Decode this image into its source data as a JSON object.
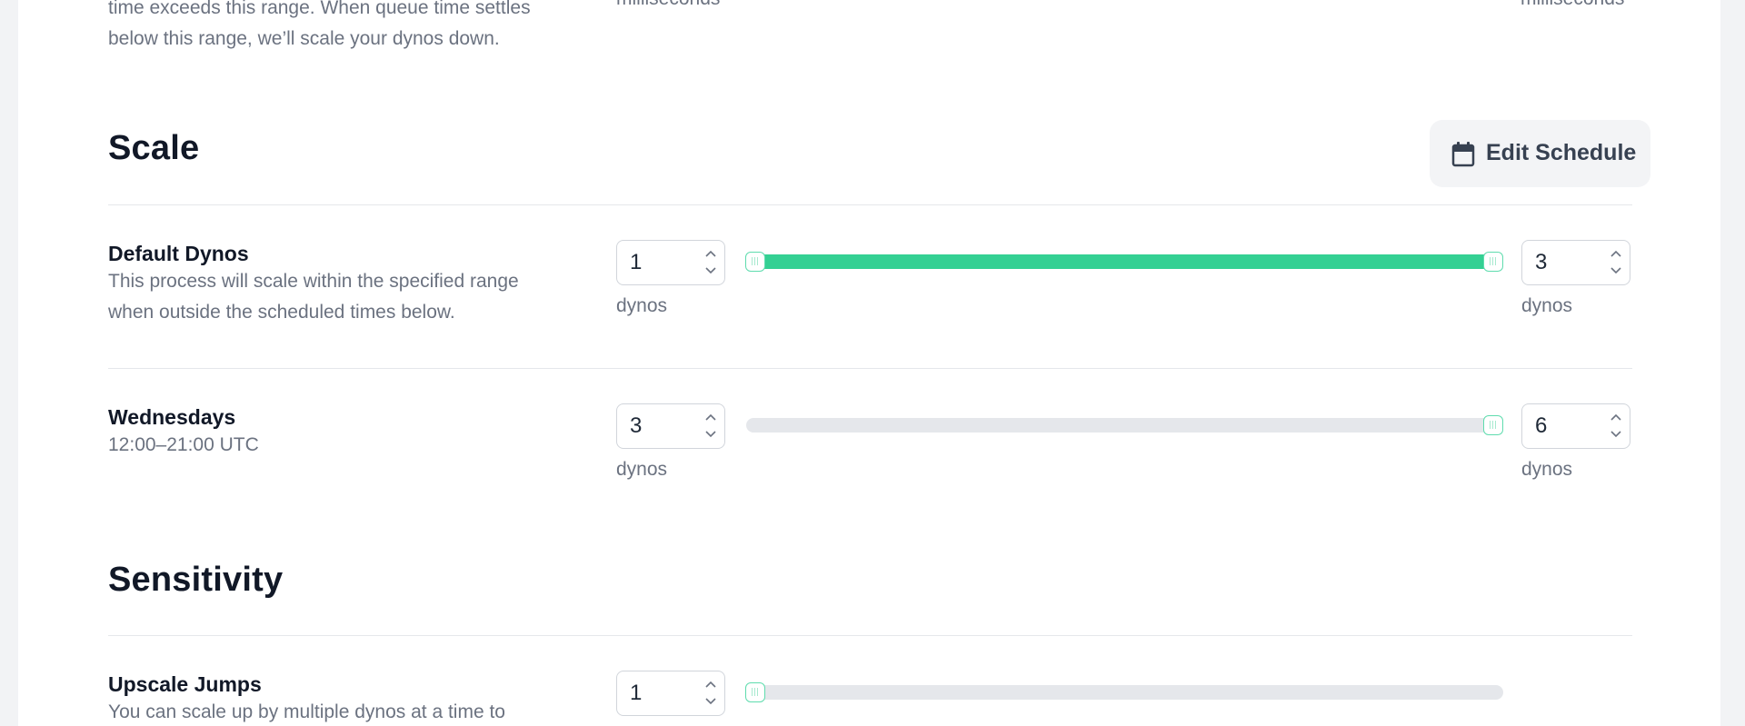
{
  "queue_time": {
    "description_line1": "time exceeds this range. When queue time settles",
    "description_line2": "below this range, we’ll scale your dynos down.",
    "min_unit": "milliseconds",
    "max_unit": "milliseconds"
  },
  "scale": {
    "title": "Scale",
    "edit_schedule_label": "Edit Schedule",
    "icon": "calendar-icon",
    "rows": [
      {
        "title": "Default Dynos",
        "description_line1": "This process will scale within the specified range",
        "description_line2": "when outside the scheduled times below.",
        "min_value": "1",
        "max_value": "3",
        "min_unit": "dynos",
        "max_unit": "dynos",
        "range_fill": 1.0
      },
      {
        "title": "Wednesdays",
        "description_line1": "12:00–21:00 UTC",
        "min_value": "3",
        "max_value": "6",
        "min_unit": "dynos",
        "max_unit": "dynos",
        "range_fill": 0.0
      }
    ]
  },
  "sensitivity": {
    "title": "Sensitivity",
    "rows": [
      {
        "title": "Upscale Jumps",
        "description_line1": "You can scale up by multiple dynos at a time to",
        "value": "1"
      }
    ]
  },
  "colors": {
    "accent": "#34d093",
    "track": "#e5e7eb",
    "text_primary": "#111827",
    "text_secondary": "#6b7280"
  }
}
